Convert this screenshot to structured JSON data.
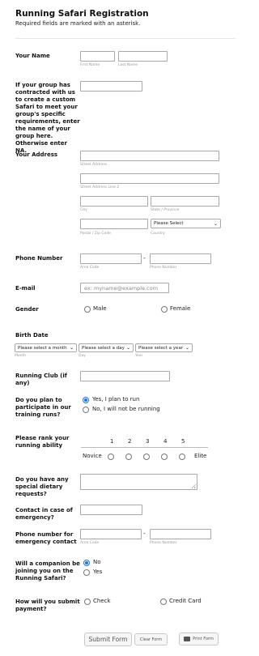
{
  "header": {
    "title": "Running Safari Registration",
    "subtitle": "Required fields are marked with an asterisk."
  },
  "name": {
    "label": "Your Name",
    "first_sub": "First Name",
    "last_sub": "Last Name"
  },
  "group": {
    "label": "If your group has contracted with us to create a custom Safari to meet your group's specific requirements, enter the name of your group here. Otherwise enter NA."
  },
  "address": {
    "label": "Your Address",
    "street_sub": "Street Address",
    "street2_sub": "Street Address Line 2",
    "city_sub": "City",
    "state_sub": "State / Province",
    "postal_sub": "Postal / Zip Code",
    "country_sub": "Country",
    "country_value": "Please Select"
  },
  "phone": {
    "label": "Phone Number",
    "area_sub": "Area Code",
    "number_sub": "Phone Number"
  },
  "email": {
    "label": "E-mail",
    "placeholder": "ex: myname@example.com"
  },
  "gender": {
    "label": "Gender",
    "options": [
      "Male",
      "Female"
    ]
  },
  "birth": {
    "label": "Birth Date",
    "month_value": "Please select a month",
    "day_value": "Please select a day",
    "year_value": "Please select a year",
    "month_sub": "Month",
    "day_sub": "Day",
    "year_sub": "Year"
  },
  "club": {
    "label": "Running Club (if any)"
  },
  "training": {
    "label": "Do you plan to participate in our training runs?",
    "options": [
      "Yes, I plan to run",
      "No, I will not be running"
    ],
    "selected_index": 0
  },
  "rank": {
    "label": "Please rank your running ability",
    "scale": [
      "1",
      "2",
      "3",
      "4",
      "5"
    ],
    "low_label": "Novice",
    "high_label": "Elite"
  },
  "dietary": {
    "label": "Do you have any special dietary requests?"
  },
  "emergency_contact": {
    "label": "Contact in case of emergency?"
  },
  "emergency_phone": {
    "label": "Phone number for emergency contact",
    "area_sub": "Area Code",
    "number_sub": "Phone Number"
  },
  "companion": {
    "label": "Will a companion be joining you on the Running Safari?",
    "options": [
      "No",
      "Yes"
    ],
    "selected_index": 0
  },
  "payment": {
    "label": "How will you submit payment?",
    "options": [
      "Check",
      "Credit Card"
    ]
  },
  "buttons": {
    "submit": "Submit Form",
    "clear": "Clear Form",
    "print": "Print Form"
  },
  "colors": {
    "accent": "#1a73e8",
    "border": "#a9a9a9"
  }
}
